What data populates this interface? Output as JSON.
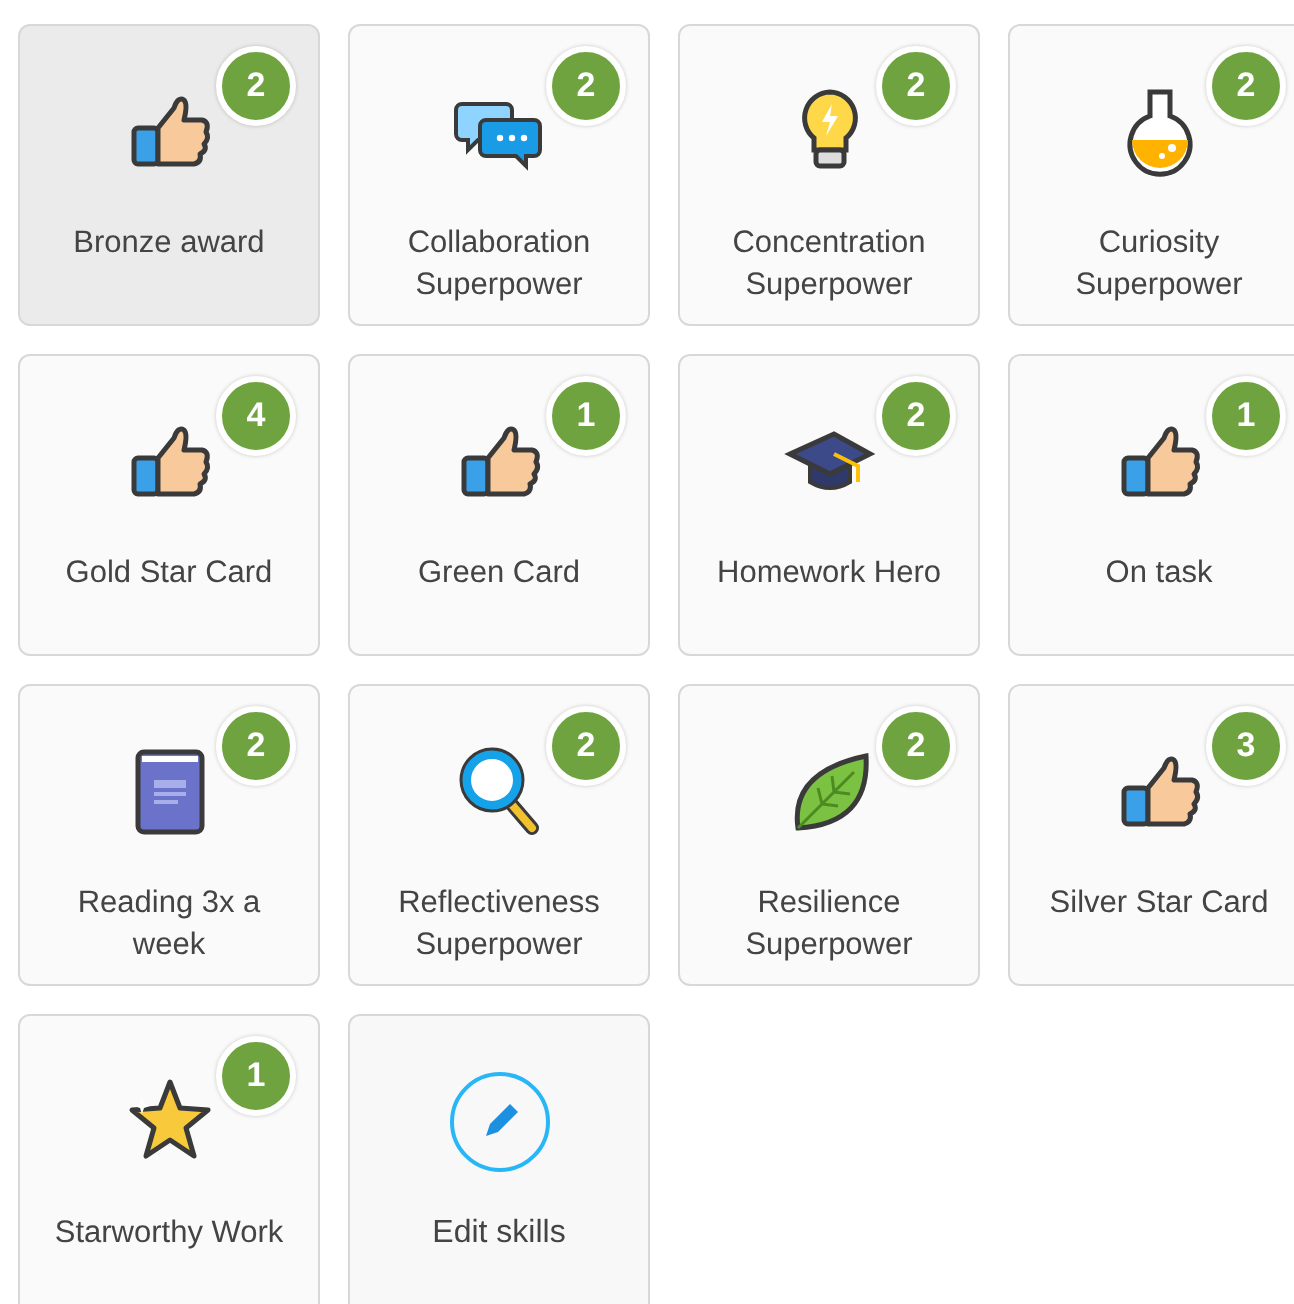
{
  "skills": [
    {
      "kind": "thumb",
      "label": "Bronze award",
      "count": "2",
      "selected": true
    },
    {
      "kind": "chat",
      "label": "Collaboration Superpower",
      "count": "2",
      "selected": false
    },
    {
      "kind": "bulb",
      "label": "Concentration Superpower",
      "count": "2",
      "selected": false
    },
    {
      "kind": "flask",
      "label": "Curiosity Superpower",
      "count": "2",
      "selected": false
    },
    {
      "kind": "thumb",
      "label": "Gold Star Card",
      "count": "4",
      "selected": false
    },
    {
      "kind": "thumb",
      "label": "Green Card",
      "count": "1",
      "selected": false
    },
    {
      "kind": "cap",
      "label": "Homework Hero",
      "count": "2",
      "selected": false
    },
    {
      "kind": "thumb",
      "label": "On task",
      "count": "1",
      "selected": false
    },
    {
      "kind": "book",
      "label": "Reading 3x a week",
      "count": "2",
      "selected": false
    },
    {
      "kind": "magnifier",
      "label": "Reflectiveness Superpower",
      "count": "2",
      "selected": false
    },
    {
      "kind": "leaf",
      "label": "Resilience Superpower",
      "count": "2",
      "selected": false
    },
    {
      "kind": "thumb",
      "label": "Silver Star Card",
      "count": "3",
      "selected": false
    },
    {
      "kind": "star",
      "label": "Starworthy Work",
      "count": "1",
      "selected": false
    }
  ],
  "edit": {
    "label": "Edit skills"
  }
}
